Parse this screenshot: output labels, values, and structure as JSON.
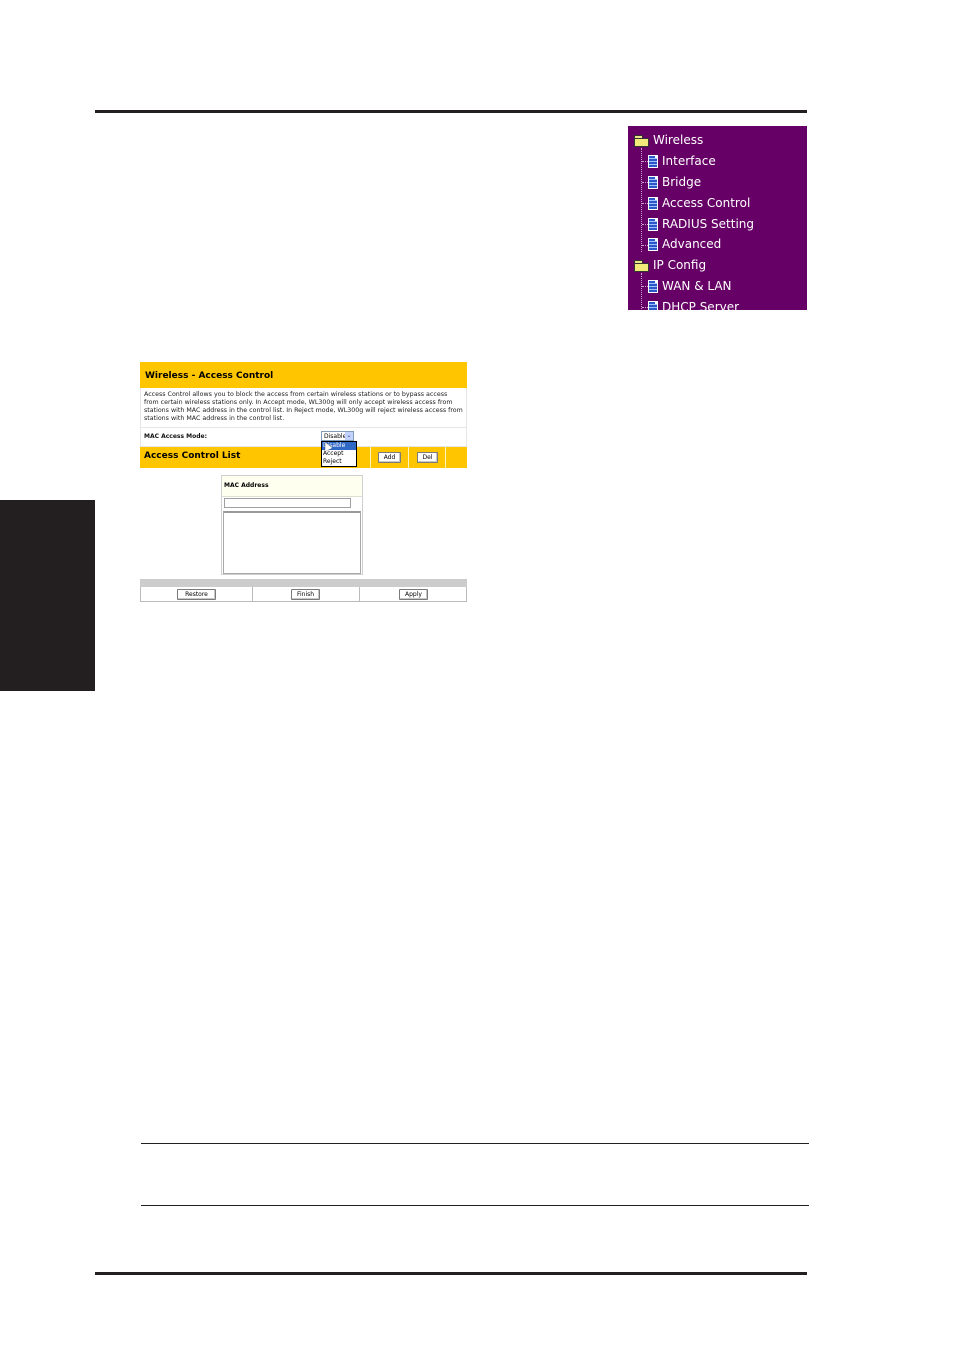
{
  "sidebar_menu": {
    "background": "#660066",
    "items": [
      {
        "label": "Wireless",
        "type": "folder",
        "icon": "folder-open-icon"
      },
      {
        "label": "Interface",
        "type": "page",
        "icon": "document-icon"
      },
      {
        "label": "Bridge",
        "type": "page",
        "icon": "document-icon"
      },
      {
        "label": "Access Control",
        "type": "page",
        "icon": "document-icon"
      },
      {
        "label": "RADIUS Setting",
        "type": "page",
        "icon": "document-icon"
      },
      {
        "label": "Advanced",
        "type": "page",
        "icon": "document-icon"
      },
      {
        "label": "IP Config",
        "type": "folder",
        "icon": "folder-open-icon"
      },
      {
        "label": "WAN & LAN",
        "type": "page",
        "icon": "document-icon"
      },
      {
        "label": "DHCP Server",
        "type": "page",
        "icon": "document-icon"
      }
    ]
  },
  "panel": {
    "accent": "#ffc600",
    "title": "Wireless - Access Control",
    "description": "Access Control allows you to block the access from certain wireless stations or to bypass access from certain wireless stations only. In Accept mode, WL300g will only accept wireless access from stations with MAC address in the control list. In Reject mode, WL300g will reject wireless access from stations with MAC address in the control list.",
    "mac_access_mode": {
      "label": "MAC Access Mode:",
      "selected": "Disable",
      "arrow": "⌄",
      "options": [
        "Disable",
        "Accept",
        "Reject"
      ],
      "highlighted": "Disable"
    },
    "acl": {
      "title": "Access Control List",
      "add_label": "Add",
      "del_label": "Del"
    },
    "mac_table": {
      "header": "MAC Address",
      "input_value": "",
      "entries": []
    },
    "footer": {
      "restore_label": "Restore",
      "finish_label": "Finish",
      "apply_label": "Apply"
    }
  }
}
